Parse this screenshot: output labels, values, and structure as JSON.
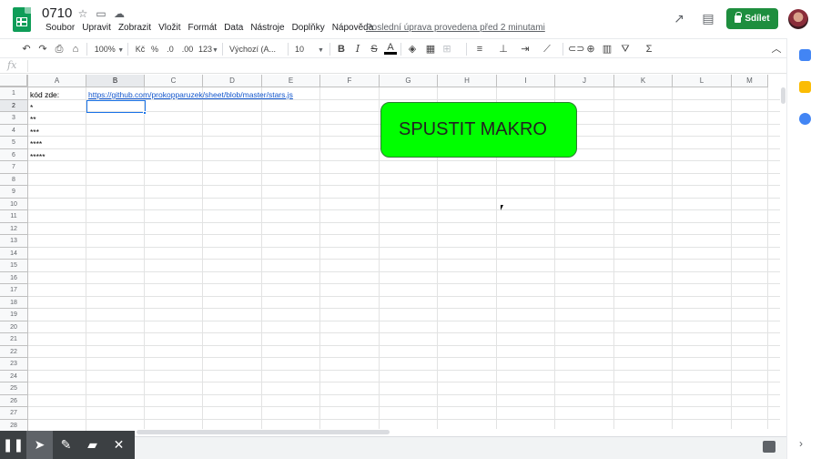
{
  "document": {
    "title": "0710",
    "last_edit": "Poslední úprava provedena před 2 minutami"
  },
  "menu": [
    "Soubor",
    "Upravit",
    "Zobrazit",
    "Vložit",
    "Formát",
    "Data",
    "Nástroje",
    "Doplňky",
    "Nápověda"
  ],
  "header_actions": {
    "share_label": "Sdílet"
  },
  "toolbar": {
    "zoom": "100%",
    "currency": "Kč",
    "percent": "%",
    "decrease_decimals": ".0",
    "increase_decimals": ".00",
    "number_format": "123",
    "font_family": "Výchozí (A...",
    "font_size": "10",
    "bold": "B",
    "italic": "I",
    "strike": "S",
    "text_color": "A"
  },
  "formula_bar": {
    "fx": "fx"
  },
  "columns": [
    "A",
    "B",
    "C",
    "D",
    "E",
    "F",
    "G",
    "H",
    "I",
    "J",
    "K",
    "L",
    "M"
  ],
  "selected_column": "B",
  "rows": [
    "1",
    "2",
    "3",
    "4",
    "5",
    "6",
    "7",
    "8",
    "9",
    "10",
    "11",
    "12",
    "13",
    "14",
    "15",
    "16",
    "17",
    "18",
    "19",
    "20",
    "21",
    "22",
    "23",
    "24",
    "25",
    "26",
    "27",
    "28"
  ],
  "selected_row": "2",
  "cells": {
    "A1": "kód zde:",
    "B1": "https://github.com/prokopparuzek/sheet/blob/master/stars.js",
    "A2": "*",
    "A3": "**",
    "A4": "***",
    "A5": "****",
    "A6": "*****"
  },
  "macro_button": {
    "label": "SPUSTIT MAKRO",
    "color": "#00ff00"
  },
  "colors": {
    "share_button": "#1e8e3e",
    "selection": "#1a73e8",
    "link": "#1155cc"
  }
}
